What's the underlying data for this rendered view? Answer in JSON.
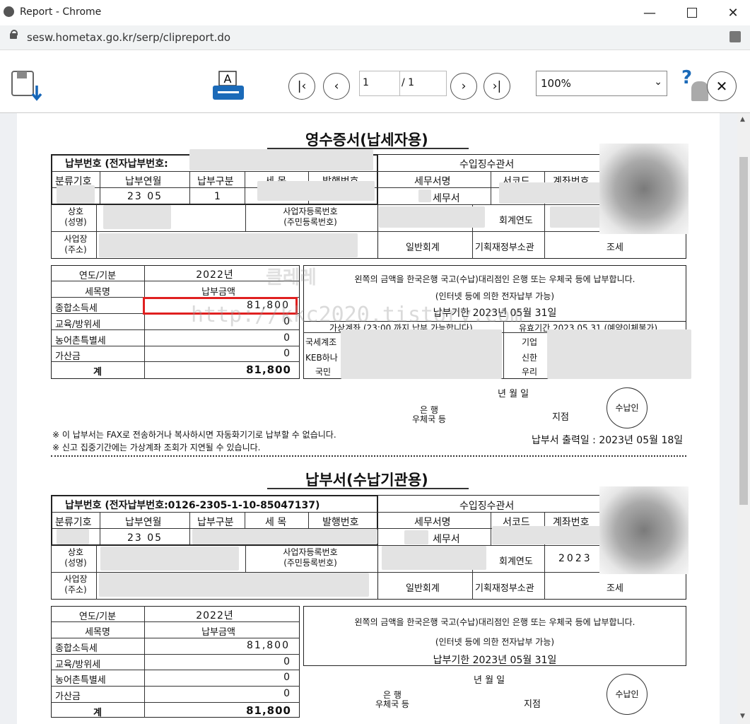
{
  "window": {
    "title": "Report - Chrome",
    "url": "sesw.hometax.go.kr/serp/clipreport.do"
  },
  "toolbar": {
    "page_current": "1",
    "page_total": "/ 1",
    "zoom": "100%",
    "help": "?",
    "close": "✕"
  },
  "watermark": {
    "line1": "클레레",
    "line2": "http://kkc2020.tistory.com"
  },
  "receipt": {
    "title": "영수증서(납세자용)",
    "payment_no_label": "납부번호 (전자납부번호:",
    "hdr": {
      "class_code": "분류기호",
      "period": "납부연월",
      "pay_type": "납부구분",
      "item": "세 목",
      "issue_no": "발행번호"
    },
    "period_value": "23 05",
    "pay_type_value": "1",
    "collector_label": "수입징수관서",
    "tax_office_name_label": "세무서명",
    "tax_office_value": "세무서",
    "office_code_label": "서코드",
    "account_no_label": "계좌번호",
    "name_label": "상호\n(성명)",
    "bizno_label": "사업자등록번호\n(주민등록번호)",
    "fiscal_year_label": "회계연도",
    "address_label": "사업장\n(주소)",
    "general_account": "일반회계",
    "ministry": "기획재정부소관",
    "tax": "조세",
    "year_label": "연도/기분",
    "year_value": "2022년",
    "item_label": "세목명",
    "amount_label": "납부금액",
    "rows": [
      {
        "name": "종합소득세",
        "amount": "81,800"
      },
      {
        "name": "교육/방위세",
        "amount": "0"
      },
      {
        "name": "농어촌특별세",
        "amount": "0"
      },
      {
        "name": "가산금",
        "amount": "0"
      }
    ],
    "total_label": "계",
    "total_value": "81,800",
    "notice1": "왼쪽의 금액을 한국은행 국고(수납)대리점인 은행 또는 우체국 등에 납부합니다.",
    "notice2": "(인터넷 등에 의한 전자납부 가능)",
    "due": "납부기한 2023년 05월 31일",
    "vaccount": "가상계좌 (23:00 까지 납부 가능합니다)",
    "validity": "유효기간  2023.05.31  (예약이체불가)",
    "banks_left": [
      "국세계조",
      "KEB하나",
      "국민"
    ],
    "banks_right": [
      "기업",
      "신한",
      "우리"
    ],
    "date_label": "년   월   일",
    "bank_label": "은     행\n우체국 등",
    "branch_label": "지점",
    "stamp": "수납인",
    "footnote1": "※ 이 납부서는 FAX로 전송하거나 복사하시면 자동화기기로 납부할 수 없습니다.",
    "footnote2": "※ 신고 집중기간에는 가상계좌 조회가 지연될 수 있습니다.",
    "print_date": "납부서 출력일 : 2023년 05월 18일"
  },
  "payslip": {
    "title": "납부서(수납기관용)",
    "payment_no": "납부번호 (전자납부번호:0126-2305-1-10-85047137)",
    "fiscal_year_value": "2023"
  }
}
